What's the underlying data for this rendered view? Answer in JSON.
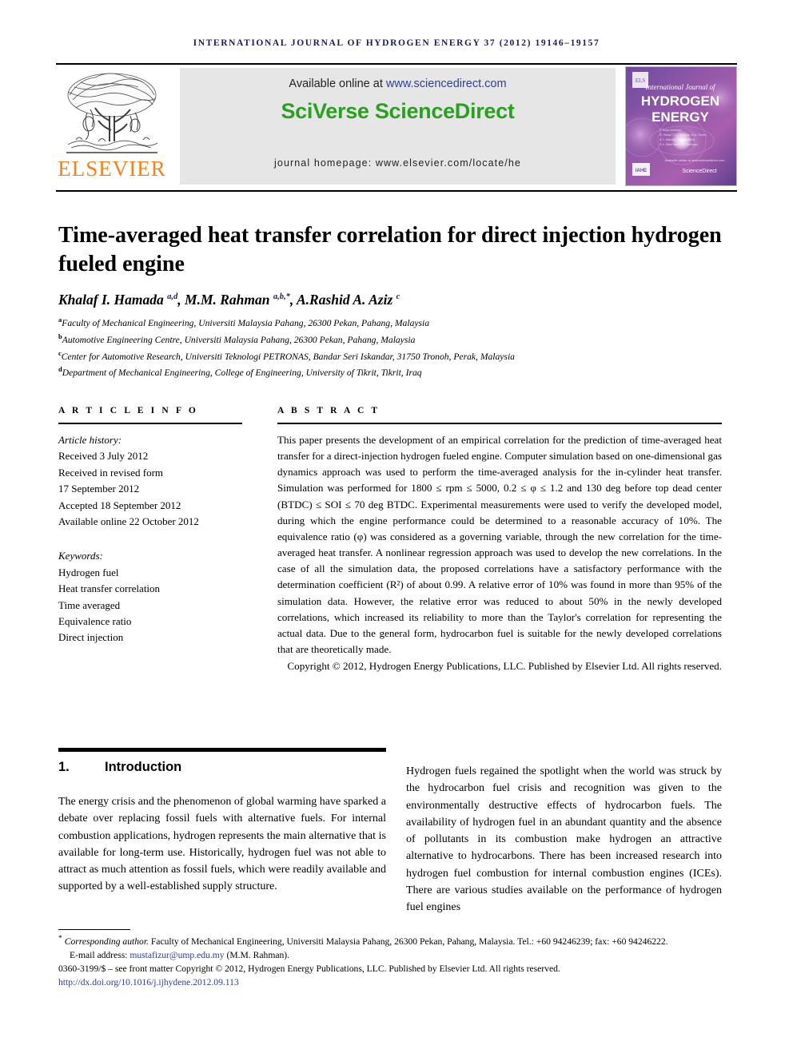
{
  "running_head": "International Journal of Hydrogen Energy 37 (2012) 19146–19157",
  "masthead": {
    "publisher_name": "ELSEVIER",
    "available_prefix": "Available online at ",
    "available_url": "www.sciencedirect.com",
    "sciencedirect_logo": "SciVerse ScienceDirect",
    "journal_homepage": "journal homepage: www.elsevier.com/locate/he",
    "cover": {
      "line1": "International Journal of",
      "line2": "HYDROGEN",
      "line3": "ENERGY",
      "badge": "IAHE",
      "footer_brand": "ScienceDirect"
    }
  },
  "article": {
    "title": "Time-averaged heat transfer correlation for direct injection hydrogen fueled engine",
    "authors_html": "Khalaf I. Hamada <sup>a,d</sup>, M.M. Rahman <sup>a,b,*</sup>, A.Rashid A. Aziz <sup>c</sup>",
    "affiliations": [
      {
        "mark": "a",
        "text": "Faculty of Mechanical Engineering, Universiti Malaysia Pahang, 26300 Pekan, Pahang, Malaysia"
      },
      {
        "mark": "b",
        "text": "Automotive Engineering Centre, Universiti Malaysia Pahang, 26300 Pekan, Pahang, Malaysia"
      },
      {
        "mark": "c",
        "text": "Center for Automotive Research, Universiti Teknologi PETRONAS, Bandar Seri Iskandar, 31750 Tronoh, Perak, Malaysia"
      },
      {
        "mark": "d",
        "text": "Department of Mechanical Engineering, College of Engineering, University of Tikrit, Tikrit, Iraq"
      }
    ]
  },
  "article_info": {
    "heading": "A R T I C L E   I N F O",
    "history_label": "Article history:",
    "history": [
      "Received 3 July 2012",
      "Received in revised form",
      "17 September 2012",
      "Accepted 18 September 2012",
      "Available online 22 October 2012"
    ],
    "keywords_label": "Keywords:",
    "keywords": [
      "Hydrogen fuel",
      "Heat transfer correlation",
      "Time averaged",
      "Equivalence ratio",
      "Direct injection"
    ]
  },
  "abstract": {
    "heading": "A B S T R A C T",
    "body": "This paper presents the development of an empirical correlation for the prediction of time-averaged heat transfer for a direct-injection hydrogen fueled engine. Computer simulation based on one-dimensional gas dynamics approach was used to perform the time-averaged analysis for the in-cylinder heat transfer. Simulation was performed for 1800 ≤ rpm ≤ 5000, 0.2 ≤ φ ≤ 1.2 and 130 deg before top dead center (BTDC) ≤ SOI ≤ 70 deg BTDC. Experimental measurements were used to verify the developed model, during which the engine performance could be determined to a reasonable accuracy of 10%. The equivalence ratio (φ) was considered as a governing variable, through the new correlation for the time-averaged heat transfer. A nonlinear regression approach was used to develop the new correlations. In the case of all the simulation data, the proposed correlations have a satisfactory performance with the determination coefficient (R²) of about 0.99. A relative error of 10% was found in more than 95% of the simulation data. However, the relative error was reduced to about 50% in the newly developed correlations, which increased its reliability to more than the Taylor's correlation for representing the actual data. Due to the general form, hydrocarbon fuel is suitable for the newly developed correlations that are theoretically made.",
    "copyright": "Copyright © 2012, Hydrogen Energy Publications, LLC. Published by Elsevier Ltd. All rights reserved."
  },
  "section": {
    "number": "1.",
    "title": "Introduction",
    "left_column": "The energy crisis and the phenomenon of global warming have sparked a debate over replacing fossil fuels with alternative fuels. For internal combustion applications, hydrogen represents the main alternative that is available for long-term use. Historically, hydrogen fuel was not able to attract as much attention as fossil fuels, which were readily available and supported by a well-established supply structure.",
    "right_column": "Hydrogen fuels regained the spotlight when the world was struck by the hydrocarbon fuel crisis and recognition was given to the environmentally destructive effects of hydrocarbon fuels. The availability of hydrogen fuel in an abundant quantity and the absence of pollutants in its combustion make hydrogen an attractive alternative to hydrocarbons. There has been increased research into hydrogen fuel combustion for internal combustion engines (ICEs). There are various studies available on the performance of hydrogen fuel engines"
  },
  "footnotes": {
    "corresponding_prefix": "Corresponding author.",
    "corresponding_text": " Faculty of Mechanical Engineering, Universiti Malaysia Pahang, 26300 Pekan, Pahang, Malaysia. Tel.: +60 94246239; fax: +60 94246222.",
    "email_label": "E-mail address: ",
    "email": "mustafizur@ump.edu.my",
    "email_suffix": " (M.M. Rahman).",
    "issn_line": "0360-3199/$ – see front matter Copyright © 2012, Hydrogen Energy Publications, LLC. Published by Elsevier Ltd. All rights reserved.",
    "doi": "http://dx.doi.org/10.1016/j.ijhydene.2012.09.113"
  },
  "colors": {
    "elsevier_orange": "#F5821F",
    "sciencedirect_green": "#2aa020",
    "link_blue": "#2b3f9e",
    "runhead_navy": "#1a1a5e",
    "band_gray": "#e6e6e6"
  }
}
